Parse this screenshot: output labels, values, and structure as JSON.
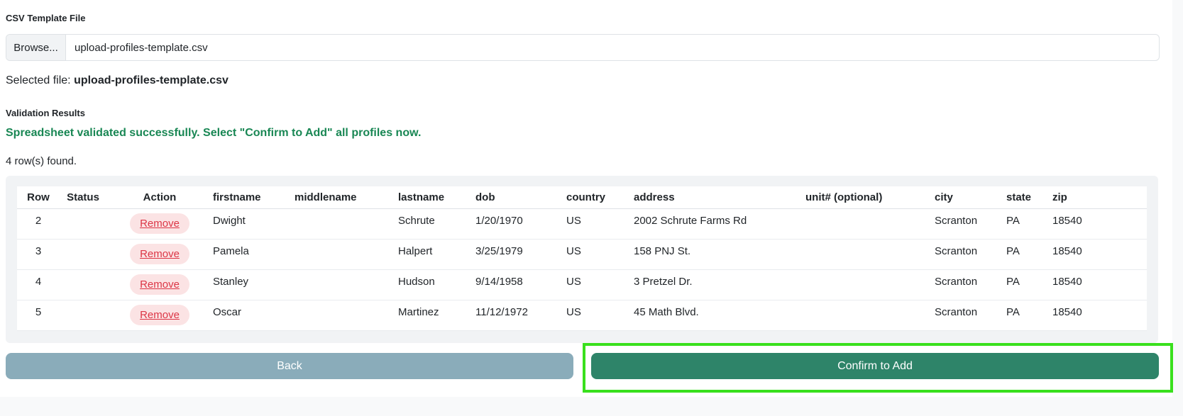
{
  "csv_label": "CSV Template File",
  "file_input": {
    "browse_label": "Browse...",
    "value": "upload-profiles-template.csv"
  },
  "selected_file": {
    "prefix": "Selected file:",
    "name": "upload-profiles-template.csv"
  },
  "validation": {
    "label": "Validation Results",
    "message": "Spreadsheet validated successfully. Select \"Confirm to Add\" all profiles now.",
    "rows_found": "4 row(s) found."
  },
  "table": {
    "headers": [
      "Row",
      "Status",
      "Action",
      "firstname",
      "middlename",
      "lastname",
      "dob",
      "country",
      "address",
      "unit# (optional)",
      "city",
      "state",
      "zip"
    ],
    "remove_label": "Remove",
    "rows": [
      {
        "row": "2",
        "status": "",
        "firstname": "Dwight",
        "middlename": "",
        "lastname": "Schrute",
        "dob": "1/20/1970",
        "country": "US",
        "address": "2002 Schrute Farms Rd",
        "unit": "",
        "city": "Scranton",
        "state": "PA",
        "zip": "18540"
      },
      {
        "row": "3",
        "status": "",
        "firstname": "Pamela",
        "middlename": "",
        "lastname": "Halpert",
        "dob": "3/25/1979",
        "country": "US",
        "address": "158 PNJ St.",
        "unit": "",
        "city": "Scranton",
        "state": "PA",
        "zip": "18540"
      },
      {
        "row": "4",
        "status": "",
        "firstname": "Stanley",
        "middlename": "",
        "lastname": "Hudson",
        "dob": "9/14/1958",
        "country": "US",
        "address": "3 Pretzel Dr.",
        "unit": "",
        "city": "Scranton",
        "state": "PA",
        "zip": "18540"
      },
      {
        "row": "5",
        "status": "",
        "firstname": "Oscar",
        "middlename": "",
        "lastname": "Martinez",
        "dob": "11/12/1972",
        "country": "US",
        "address": "45 Math Blvd.",
        "unit": "",
        "city": "Scranton",
        "state": "PA",
        "zip": "18540"
      }
    ]
  },
  "buttons": {
    "back": "Back",
    "confirm": "Confirm to Add"
  },
  "colors": {
    "success_text": "#198754",
    "remove_text": "#dc3545",
    "back_button": "#8aacba",
    "confirm_button": "#2e8469",
    "highlight": "#39e01d"
  }
}
